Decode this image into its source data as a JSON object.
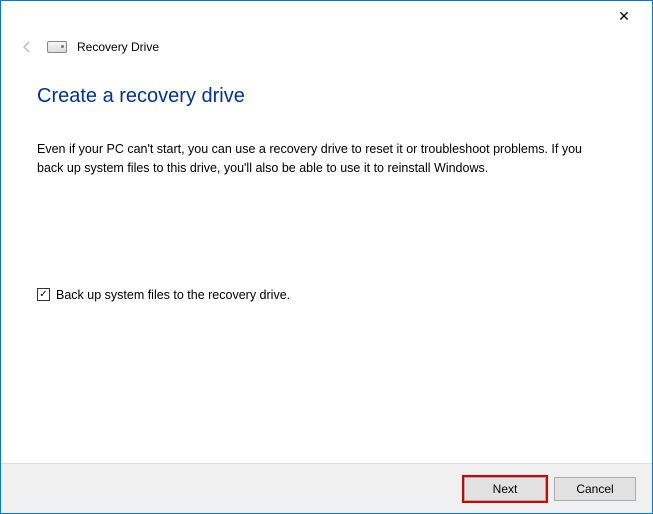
{
  "titlebar": {
    "close_glyph": "✕"
  },
  "header": {
    "title": "Recovery Drive"
  },
  "page": {
    "heading": "Create a recovery drive",
    "description": "Even if your PC can't start, you can use a recovery drive to reset it or troubleshoot problems. If you back up system files to this drive, you'll also be able to use it to reinstall Windows."
  },
  "checkbox": {
    "label": "Back up system files to the recovery drive.",
    "checked_glyph": "✓",
    "checked": true
  },
  "footer": {
    "next_label": "Next",
    "cancel_label": "Cancel"
  }
}
